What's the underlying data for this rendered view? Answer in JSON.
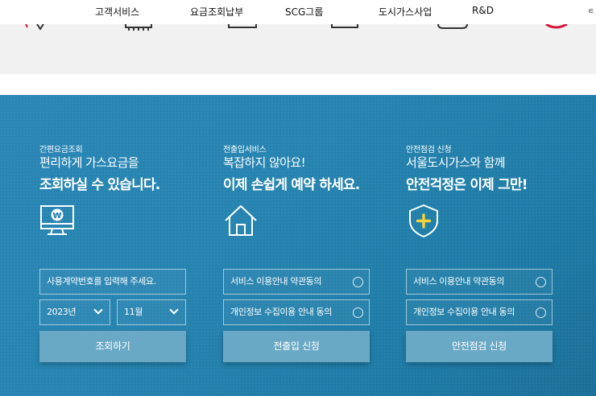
{
  "nav": {
    "items": [
      "고객서비스",
      "요금조회납부",
      "SCG그룹",
      "도시가스사업",
      "R&D"
    ],
    "stub": "ㅌ"
  },
  "columns": [
    {
      "label": "간편요금조회",
      "heading_line1": "편리하게 가스요금을",
      "heading_line2": "조회하실 수 있습니다.",
      "icon": "monitor-won-icon",
      "contract_placeholder": "사용계약번호를 입력해 주세요.",
      "year": "2023년",
      "month": "11월",
      "button": "조회하기"
    },
    {
      "label": "전출입서비스",
      "heading_line1": "복잡하지 않아요!",
      "heading_line2": "이제 손쉽게 예약 하세요.",
      "icon": "house-icon",
      "terms": [
        "서비스 이용안내 약관동의",
        "개인정보 수집이용 안내 동의"
      ],
      "button": "전출입 신청"
    },
    {
      "label": "안전점검 신청",
      "heading_line1": "서울도시가스와 함께",
      "heading_line2": "안전걱정은 이제 그만!",
      "icon": "shield-plus-icon",
      "terms": [
        "서비스 이용안내 약관동의",
        "개인정보 수집이용 안내 동의"
      ],
      "button": "안전점검 신청"
    }
  ],
  "colors": {
    "panel": "#2684b0",
    "button": "#6aa9c6",
    "strip": "#f1f1f1"
  }
}
